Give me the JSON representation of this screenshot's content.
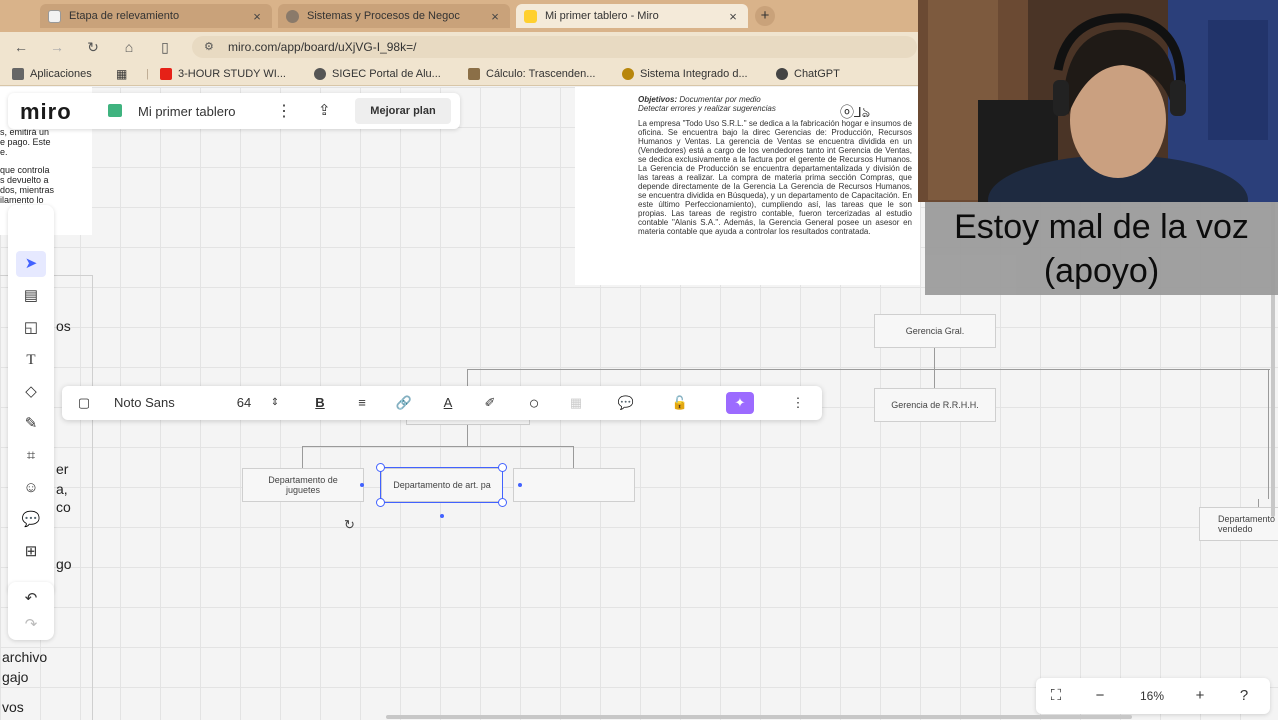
{
  "browser": {
    "tabs": [
      {
        "label": "Etapa de relevamiento",
        "active": false,
        "fav_color": "#f2f2f2"
      },
      {
        "label": "Sistemas y Procesos de Negoc",
        "active": false,
        "fav_color": "#8a7a6a"
      },
      {
        "label": "Mi primer tablero - Miro",
        "active": true,
        "fav_color": "#ffd02f"
      }
    ],
    "new_tab_label": "+",
    "url": "miro.com/app/board/uXjVG-I_98k=/",
    "bookmarks": [
      {
        "label": "Aplicaciones",
        "icon_color": "#666666"
      },
      {
        "label": "3-HOUR STUDY WI...",
        "icon_color": "#e62117"
      },
      {
        "label": "SIGEC Portal de Alu...",
        "icon_color": "#555555"
      },
      {
        "label": "Cálculo: Trascenden...",
        "icon_color": "#8b6f47"
      },
      {
        "label": "Sistema Integrado d...",
        "icon_color": "#b8860b"
      },
      {
        "label": "ChatGPT",
        "icon_color": "#444444"
      }
    ]
  },
  "miro": {
    "logo": "miro",
    "board_name": "Mi primer tablero",
    "upgrade_label": "Mejorar plan",
    "left_sticky_lines": [
      "s, emitirá un",
      "e pago. Este",
      "e.",
      "",
      "que controla",
      "s devuelto a",
      "dos, mientras",
      "ilamento lo"
    ],
    "left_col_text": [
      "os",
      "er",
      "a,",
      "co",
      "go",
      "archivo",
      "gajo",
      "vos"
    ],
    "doc": {
      "objectives_label": "Objetivos:",
      "objectives_text": "Documentar por medio",
      "objectives_line2": "Detectar errores y realizar sugerencias",
      "body": "La empresa \"Todo Uso S.R.L.\" se dedica a la fabricación hogar e insumos de oficina. Se encuentra bajo la direc Gerencias de: Producción, Recursos Humanos y Ventas. La gerencia de Ventas se encuentra dividida en un (Vendedores) está a cargo de los vendedores tanto int Gerencia de Ventas, se dedica exclusivamente a la factura por el gerente de Recursos Humanos. La Gerencia de Producción se encuentra departamentalizada y división de las tareas a realizar. La compra de materia prima sección Compras, que depende directamente de la Gerencia La Gerencia de Recursos Humanos, se encuentra dividida en Búsqueda), y un departamento de Capacitación. En este último Perfeccionamiento), cumpliendo así, las tareas que le son propias. Las tareas de registro contable, fueron tercerizadas al estudio contable \"Alanis S.A.\". Además, la Gerencia General posee un asesor en materia contable que ayuda a controlar los resultados contratada."
    },
    "nodes": {
      "gerencia_gral": "Gerencia Gral.",
      "gerencia_rrhh": "Gerencia de R.R.H.H.",
      "depto_juguetes": "Departamento de juguetes",
      "depto_art": "Departamento de art. pa",
      "depto_vendedores": "Departamento vendedo"
    },
    "text_toolbar": {
      "font": "Noto Sans",
      "size": "64"
    },
    "zoom": "16%"
  },
  "caption": {
    "line1": "Estoy mal de la voz",
    "line2": "(apoyo)"
  },
  "colors": {
    "accent": "#4262ff",
    "ai_purple": "#9c6bff",
    "tabbar": "#d9b38a"
  }
}
